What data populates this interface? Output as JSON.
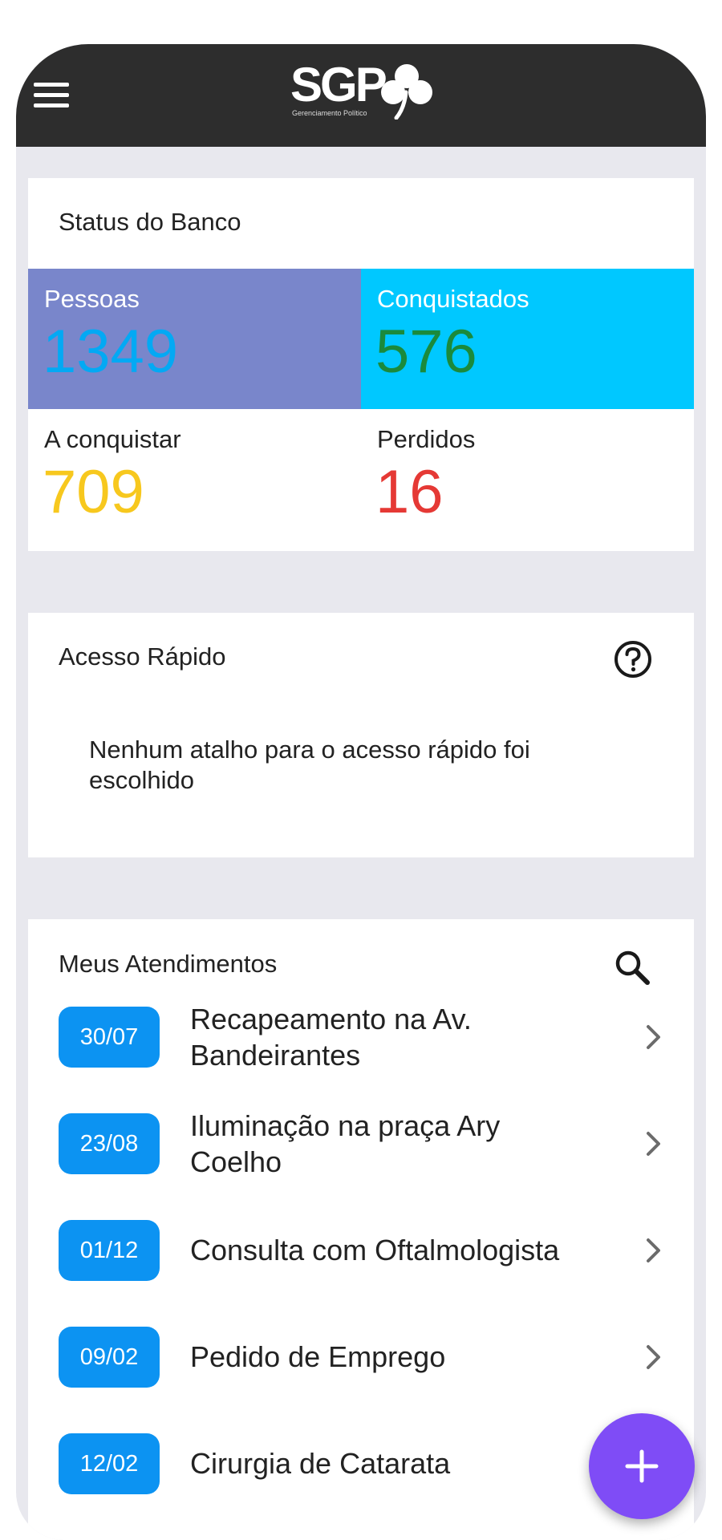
{
  "header": {
    "logo_text": "SGP",
    "logo_subtitle": "Gerenciamento Político",
    "menu_icon": "hamburger-menu-icon",
    "logo_icon": "clover-icon",
    "background": "#2d2d2d"
  },
  "status": {
    "title": "Status do Banco",
    "stats": [
      {
        "label": "Pessoas",
        "value": "1349",
        "bg": "#7986cb",
        "label_color": "#ffffff",
        "value_color": "#03a9f4"
      },
      {
        "label": "Conquistados",
        "value": "576",
        "bg": "#00c8ff",
        "label_color": "#ffffff",
        "value_color": "#1b8a3c"
      },
      {
        "label": "A conquistar",
        "value": "709",
        "bg": "#ffffff",
        "label_color": "#222222",
        "value_color": "#f7c81e"
      },
      {
        "label": "Perdidos",
        "value": "16",
        "bg": "#ffffff",
        "label_color": "#222222",
        "value_color": "#e53935"
      }
    ]
  },
  "quick_access": {
    "title": "Acesso Rápido",
    "help_icon": "help-circle-icon",
    "empty_message": "Nenhum atalho para o acesso rápido foi escolhido"
  },
  "appointments": {
    "title": "Meus Atendimentos",
    "search_icon": "search-icon",
    "badge_color": "#0c93f2",
    "items": [
      {
        "date": "30/07",
        "line1": "Recapeamento na Av.",
        "line2": "Bandeirantes"
      },
      {
        "date": "23/08",
        "line1": "Iluminação na praça Ary",
        "line2": "Coelho"
      },
      {
        "date": "01/12",
        "line1": "Consulta com Oftalmologista",
        "line2": ""
      },
      {
        "date": "09/02",
        "line1": "Pedido de Emprego",
        "line2": ""
      },
      {
        "date": "12/02",
        "line1": "Cirurgia de Catarata",
        "line2": ""
      }
    ]
  },
  "fab": {
    "icon": "plus-icon",
    "color": "#7f4cf6"
  }
}
